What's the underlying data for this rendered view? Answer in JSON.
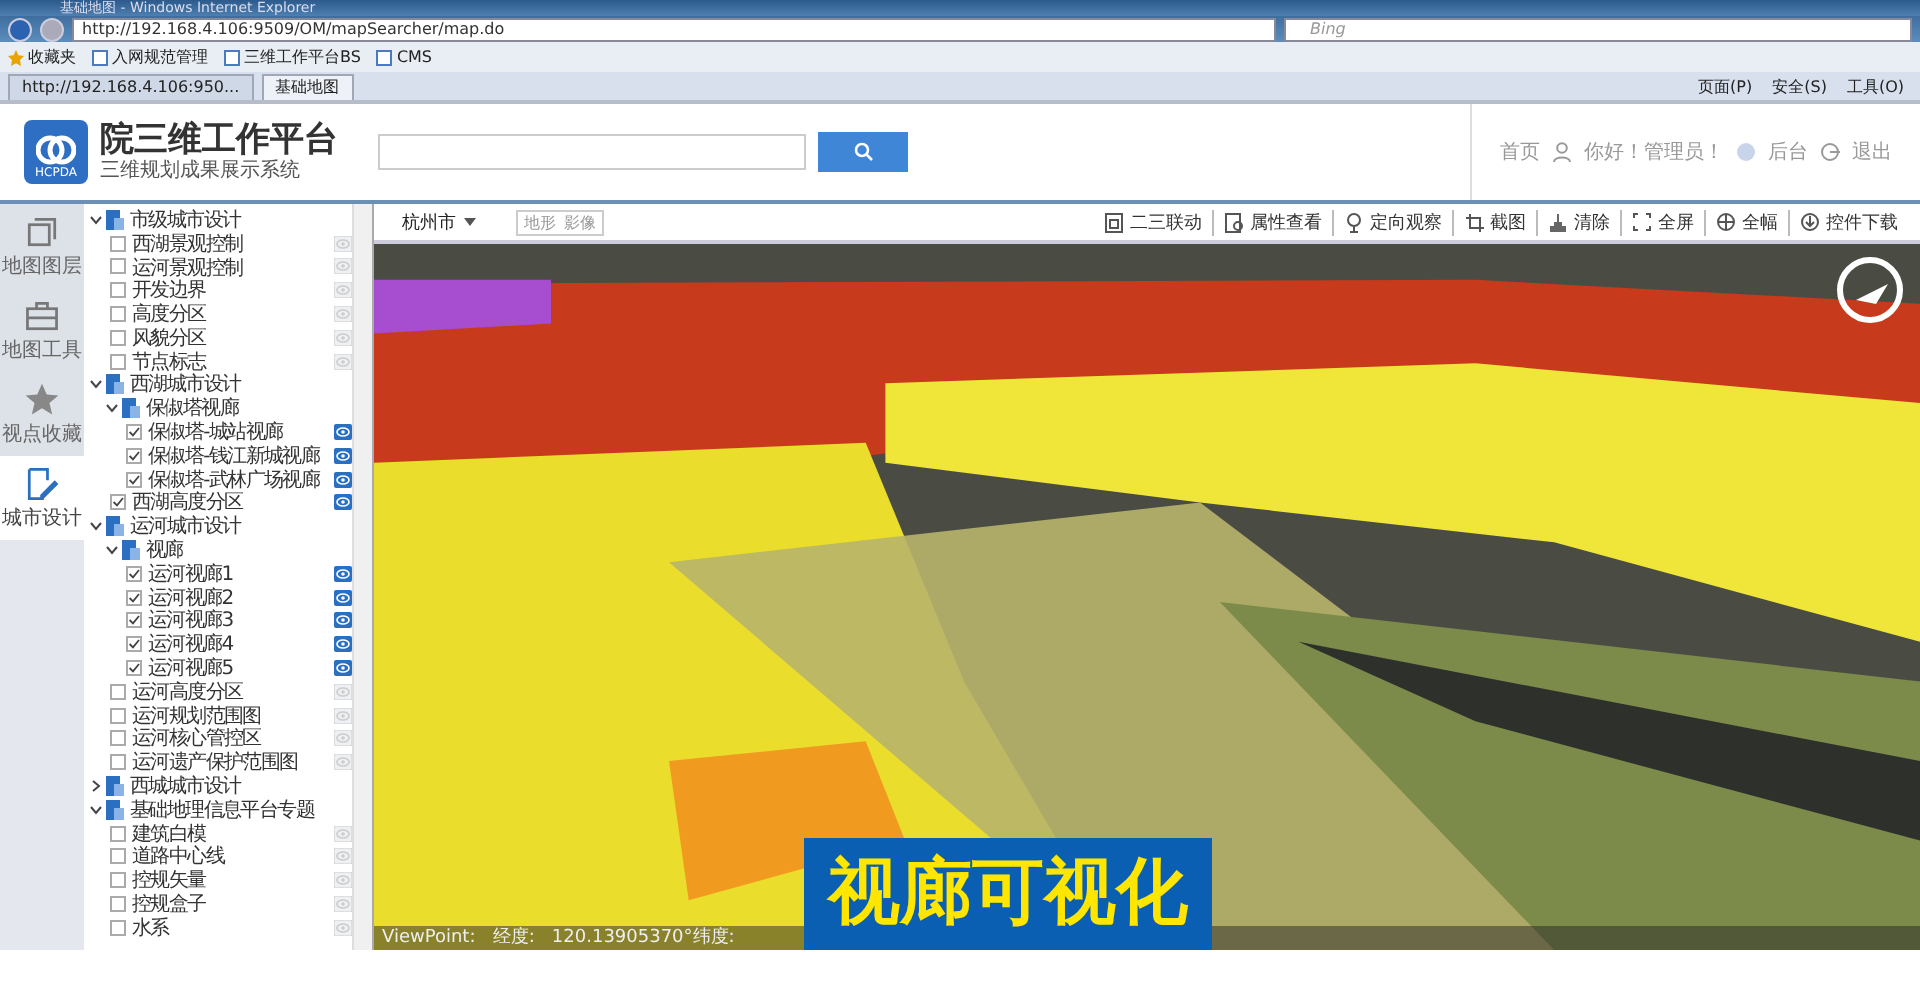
{
  "browser": {
    "title": "基础地图 - Windows Internet Explorer",
    "address": "http://192.168.4.106:9509/OM/mapSearcher/map.do",
    "search_placeholder": "Bing",
    "favorites": [
      "收藏夹",
      "入网规范管理",
      "三维工作平台BS",
      "CMS"
    ],
    "tabs": [
      {
        "label": "http://192.168.4.106:950...",
        "selected": false
      },
      {
        "label": "基础地图",
        "selected": true
      }
    ],
    "commands": [
      "页面(P)",
      "安全(S)",
      "工具(O)"
    ]
  },
  "header": {
    "logo_text": "HCPDA",
    "title": "院三维工作平台",
    "subtitle": "三维规划成果展示系统",
    "links": [
      "首页",
      "你好！管理员！",
      "后台",
      "退出"
    ]
  },
  "rail": [
    {
      "label": "地图图层",
      "selected": false
    },
    {
      "label": "地图工具",
      "selected": false
    },
    {
      "label": "视点收藏",
      "selected": false
    },
    {
      "label": "城市设计",
      "selected": true
    }
  ],
  "tree": [
    {
      "kind": "folder",
      "label": "市级城市设计",
      "expanded": true,
      "children": [
        {
          "kind": "layer",
          "label": "西湖景观控制",
          "checked": false,
          "visible": false
        },
        {
          "kind": "layer",
          "label": "运河景观控制",
          "checked": false,
          "visible": false
        },
        {
          "kind": "layer",
          "label": "开发边界",
          "checked": false,
          "visible": false
        },
        {
          "kind": "layer",
          "label": "高度分区",
          "checked": false,
          "visible": false
        },
        {
          "kind": "layer",
          "label": "风貌分区",
          "checked": false,
          "visible": false
        },
        {
          "kind": "layer",
          "label": "节点标志",
          "checked": false,
          "visible": false
        }
      ]
    },
    {
      "kind": "folder",
      "label": "西湖城市设计",
      "expanded": true,
      "children": [
        {
          "kind": "folder",
          "label": "保俶塔视廊",
          "expanded": true,
          "children": [
            {
              "kind": "layer",
              "label": "保俶塔-城站视廊",
              "checked": true,
              "visible": true
            },
            {
              "kind": "layer",
              "label": "保俶塔-钱江新城视廊",
              "checked": true,
              "visible": true
            },
            {
              "kind": "layer",
              "label": "保俶塔-武林广场视廊",
              "checked": true,
              "visible": true
            }
          ]
        },
        {
          "kind": "layer",
          "label": "西湖高度分区",
          "checked": true,
          "visible": true
        }
      ]
    },
    {
      "kind": "folder",
      "label": "运河城市设计",
      "expanded": true,
      "children": [
        {
          "kind": "folder",
          "label": "视廊",
          "expanded": true,
          "children": [
            {
              "kind": "layer",
              "label": "运河视廊1",
              "checked": true,
              "visible": true
            },
            {
              "kind": "layer",
              "label": "运河视廊2",
              "checked": true,
              "visible": true
            },
            {
              "kind": "layer",
              "label": "运河视廊3",
              "checked": true,
              "visible": true
            },
            {
              "kind": "layer",
              "label": "运河视廊4",
              "checked": true,
              "visible": true
            },
            {
              "kind": "layer",
              "label": "运河视廊5",
              "checked": true,
              "visible": true
            }
          ]
        },
        {
          "kind": "layer",
          "label": "运河高度分区",
          "checked": false,
          "visible": false
        },
        {
          "kind": "layer",
          "label": "运河规划范围图",
          "checked": false,
          "visible": false
        },
        {
          "kind": "layer",
          "label": "运河核心管控区",
          "checked": false,
          "visible": false
        },
        {
          "kind": "layer",
          "label": "运河遗产保护范围图",
          "checked": false,
          "visible": false
        }
      ]
    },
    {
      "kind": "folder",
      "label": "西城城市设计",
      "expanded": false
    },
    {
      "kind": "folder",
      "label": "基础地理信息平台专题",
      "expanded": true,
      "children": [
        {
          "kind": "layer",
          "label": "建筑白模",
          "checked": false,
          "visible": false
        },
        {
          "kind": "layer",
          "label": "道路中心线",
          "checked": false,
          "visible": false
        },
        {
          "kind": "layer",
          "label": "控规矢量",
          "checked": false,
          "visible": false
        },
        {
          "kind": "layer",
          "label": "控规盒子",
          "checked": false,
          "visible": false
        },
        {
          "kind": "layer",
          "label": "水系",
          "checked": false,
          "visible": false
        }
      ]
    }
  ],
  "map_toolbar": {
    "city": "杭州市",
    "modes": [
      {
        "label": "地形",
        "selected": false
      },
      {
        "label": "影像",
        "selected": false
      }
    ],
    "tools": [
      "二三联动",
      "属性查看",
      "定向观察",
      "截图",
      "清除",
      "全屏",
      "全幅",
      "控件下载"
    ]
  },
  "map": {
    "status": "ViewPoint:   经度:   120.13905370°纬度:",
    "caption": "视廊可视化"
  }
}
